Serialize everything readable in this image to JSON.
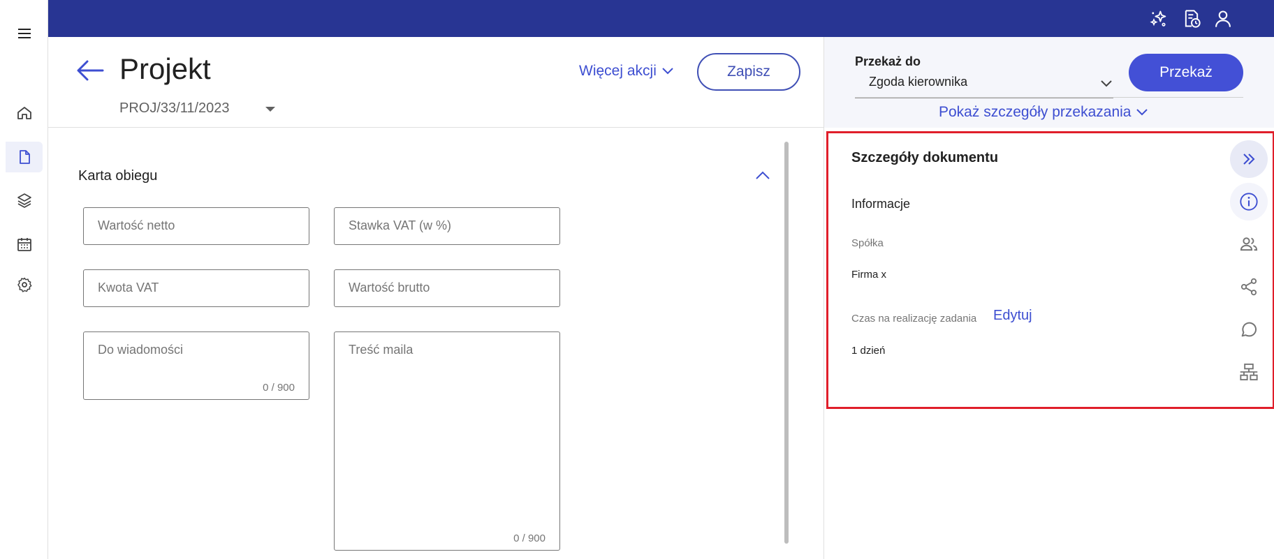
{
  "header": {
    "title": "Projekt",
    "doc_number": "PROJ/33/11/2023",
    "more_actions_label": "Więcej akcji",
    "save_label": "Zapisz"
  },
  "form": {
    "section_title": "Karta obiegu",
    "fields": {
      "net_value": "Wartość netto",
      "vat_rate": "Stawka VAT (w %)",
      "vat_amount": "Kwota VAT",
      "gross_value": "Wartość brutto",
      "cc": "Do wiadomości",
      "cc_counter": "0 / 900",
      "mail_body": "Treść maila",
      "mail_counter": "0 / 900"
    }
  },
  "transfer": {
    "label": "Przekaż do",
    "selected": "Zgoda kierownika",
    "button_label": "Przekaż",
    "show_details_label": "Pokaż szczegóły przekazania"
  },
  "details": {
    "title": "Szczegóły dokumentu",
    "info_heading": "Informacje",
    "company_label": "Spółka",
    "company_value": "Firma x",
    "time_label": "Czas na realizację zadania",
    "edit_label": "Edytuj",
    "time_value": "1 dzień"
  },
  "colors": {
    "topbar": "#283593",
    "accent": "#3d4ed1",
    "highlight_frame": "#e01e2a"
  }
}
